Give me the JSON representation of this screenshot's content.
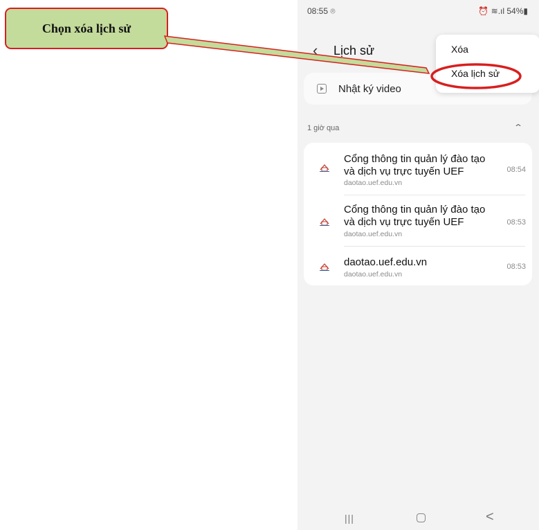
{
  "annotation": {
    "callout_text": "Chọn xóa lịch sử",
    "callout_fill": "#c3db9b",
    "highlight_color": "#e3181b"
  },
  "status_bar": {
    "time": "08:55 ⌾",
    "icons_text": "⏰ ≋.ıl 54%▮"
  },
  "app_bar": {
    "back_icon": "chevron-left-icon",
    "title": "Lịch sử"
  },
  "video_history": {
    "icon": "play-square-icon",
    "label": "Nhật ký video"
  },
  "section": {
    "label": "1 giờ qua",
    "collapse_icon": "chevron-up-icon"
  },
  "history_items": [
    {
      "title": "Cổng thông tin quản lý đào tạo và dịch vụ trực tuyến UEF",
      "url": "daotao.uef.edu.vn",
      "time": "08:54",
      "icon": "uef-favicon"
    },
    {
      "title": "Cổng thông tin quản lý đào tạo và dịch vụ trực tuyến UEF",
      "url": "daotao.uef.edu.vn",
      "time": "08:53",
      "icon": "uef-favicon"
    },
    {
      "title": "daotao.uef.edu.vn",
      "url": "daotao.uef.edu.vn",
      "time": "08:53",
      "icon": "uef-favicon"
    }
  ],
  "menu": {
    "items": [
      "Xóa",
      "Xóa lịch sử"
    ]
  },
  "nav_bar": {
    "recent": "|||",
    "home_icon": "home-icon",
    "back": "<"
  }
}
